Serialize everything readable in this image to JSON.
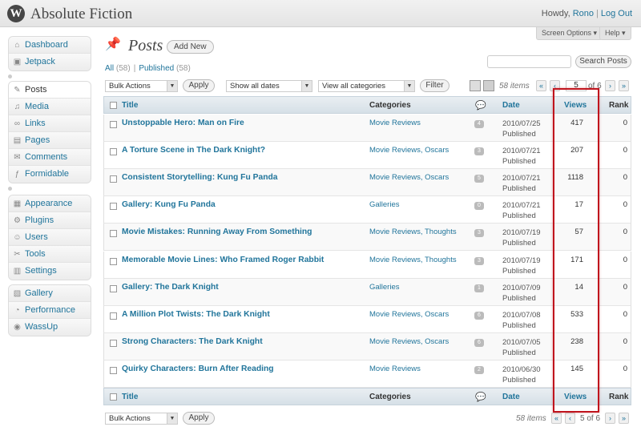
{
  "header": {
    "site_title": "Absolute Fiction",
    "howdy": "Howdy,",
    "username": "Rono",
    "logout": "Log Out",
    "logo_glyph": "W"
  },
  "screen_meta": {
    "screen_options": "Screen Options ▾",
    "help": "Help ▾"
  },
  "sidebar": {
    "group1": [
      {
        "label": "Dashboard",
        "icon": "dashboard-icon",
        "glyph": "⌂"
      },
      {
        "label": "Jetpack",
        "icon": "jetpack-icon",
        "glyph": "▣"
      }
    ],
    "group2": [
      {
        "label": "Posts",
        "icon": "pin-icon",
        "glyph": "✎",
        "current": true
      },
      {
        "label": "Media",
        "icon": "media-icon",
        "glyph": "♫"
      },
      {
        "label": "Links",
        "icon": "links-icon",
        "glyph": "∞"
      },
      {
        "label": "Pages",
        "icon": "pages-icon",
        "glyph": "▤"
      },
      {
        "label": "Comments",
        "icon": "comments-icon",
        "glyph": "✉"
      },
      {
        "label": "Formidable",
        "icon": "formidable-icon",
        "glyph": "ƒ"
      }
    ],
    "group3": [
      {
        "label": "Appearance",
        "icon": "appearance-icon",
        "glyph": "▦"
      },
      {
        "label": "Plugins",
        "icon": "plugins-icon",
        "glyph": "⚙"
      },
      {
        "label": "Users",
        "icon": "users-icon",
        "glyph": "☺"
      },
      {
        "label": "Tools",
        "icon": "tools-icon",
        "glyph": "✂"
      },
      {
        "label": "Settings",
        "icon": "settings-icon",
        "glyph": "▥"
      }
    ],
    "group4": [
      {
        "label": "Gallery",
        "icon": "gallery-icon",
        "glyph": "▧"
      },
      {
        "label": "Performance",
        "icon": "performance-icon",
        "glyph": "◔"
      },
      {
        "label": "WassUp",
        "icon": "wassup-icon",
        "glyph": "◉"
      }
    ]
  },
  "page": {
    "title": "Posts",
    "add_new": "Add New",
    "filter_all": "All",
    "filter_all_count": "(58)",
    "filter_published": "Published",
    "filter_published_count": "(58)",
    "search_button": "Search Posts"
  },
  "toolbar_top": {
    "bulk_actions": "Bulk Actions",
    "apply": "Apply",
    "dates": "Show all dates",
    "categories": "View all categories",
    "filter": "Filter",
    "items": "58 items",
    "first": "«",
    "prev": "‹",
    "current_page": "5",
    "of_pages": "of 6",
    "next": "›",
    "last": "»"
  },
  "toolbar_bottom": {
    "bulk_actions": "Bulk Actions",
    "apply": "Apply",
    "items": "58 items",
    "first": "«",
    "prev": "‹",
    "paging": "5 of 6",
    "next": "›",
    "last": "»"
  },
  "columns": {
    "title": "Title",
    "categories": "Categories",
    "date": "Date",
    "views": "Views",
    "rank": "Rank"
  },
  "posts": [
    {
      "title": "Unstoppable Hero: Man on Fire",
      "categories": "Movie Reviews",
      "comments": "4",
      "date": "2010/07/25",
      "status": "Published",
      "views": "417",
      "rank": "0"
    },
    {
      "title": "A Torture Scene in The Dark Knight?",
      "categories": "Movie Reviews, Oscars",
      "comments": "3",
      "date": "2010/07/21",
      "status": "Published",
      "views": "207",
      "rank": "0"
    },
    {
      "title": "Consistent Storytelling: Kung Fu Panda",
      "categories": "Movie Reviews, Oscars",
      "comments": "5",
      "date": "2010/07/21",
      "status": "Published",
      "views": "1118",
      "rank": "0"
    },
    {
      "title": "Gallery: Kung Fu Panda",
      "categories": "Galleries",
      "comments": "0",
      "date": "2010/07/21",
      "status": "Published",
      "views": "17",
      "rank": "0"
    },
    {
      "title": "Movie Mistakes: Running Away From Something",
      "categories": "Movie Reviews, Thoughts",
      "comments": "3",
      "date": "2010/07/19",
      "status": "Published",
      "views": "57",
      "rank": "0"
    },
    {
      "title": "Memorable Movie Lines: Who Framed Roger Rabbit",
      "categories": "Movie Reviews, Thoughts",
      "comments": "3",
      "date": "2010/07/19",
      "status": "Published",
      "views": "171",
      "rank": "0"
    },
    {
      "title": "Gallery: The Dark Knight",
      "categories": "Galleries",
      "comments": "1",
      "date": "2010/07/09",
      "status": "Published",
      "views": "14",
      "rank": "0"
    },
    {
      "title": "A Million Plot Twists: The Dark Knight",
      "categories": "Movie Reviews, Oscars",
      "comments": "6",
      "date": "2010/07/08",
      "status": "Published",
      "views": "533",
      "rank": "0"
    },
    {
      "title": "Strong Characters: The Dark Knight",
      "categories": "Movie Reviews, Oscars",
      "comments": "6",
      "date": "2010/07/05",
      "status": "Published",
      "views": "238",
      "rank": "0"
    },
    {
      "title": "Quirky Characters: Burn After Reading",
      "categories": "Movie Reviews",
      "comments": "2",
      "date": "2010/06/30",
      "status": "Published",
      "views": "145",
      "rank": "0"
    }
  ],
  "colors": {
    "link": "#21759b",
    "highlight": "#c0141d"
  }
}
